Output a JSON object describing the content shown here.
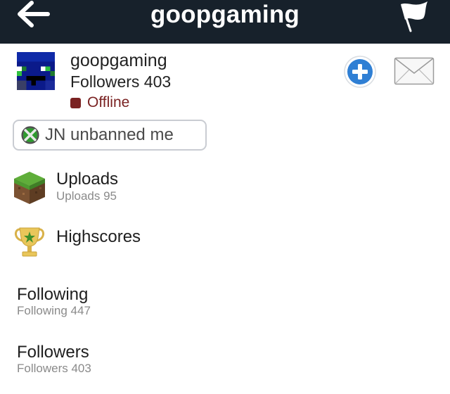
{
  "nav": {
    "title": "goopgaming"
  },
  "profile": {
    "name": "goopgaming",
    "followers_text": "Followers 403",
    "status": "Offline",
    "status_color": "#7a2222",
    "status_message": "JN unbanned me"
  },
  "menu": {
    "uploads": {
      "label": "Uploads",
      "sub": "Uploads 95"
    },
    "highscores": {
      "label": "Highscores"
    },
    "following": {
      "label": "Following",
      "sub": "Following 447"
    },
    "followers": {
      "label": "Followers",
      "sub": "Followers 403"
    }
  },
  "colors": {
    "nav_bg": "#17212b",
    "accent_blue": "#2f7fd4"
  },
  "icons": {
    "back": "back-arrow-icon",
    "flag": "flag-icon",
    "add": "add-friend-icon",
    "mail": "mail-icon",
    "xbox": "xbox-icon",
    "uploads": "grass-block-icon",
    "highscores": "trophy-icon"
  }
}
